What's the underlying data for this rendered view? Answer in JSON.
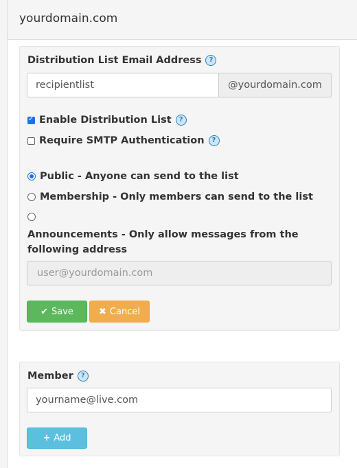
{
  "domain_title": "yourdomain.com",
  "dist_list": {
    "label": "Distribution List Email Address",
    "email_value": "recipientlist",
    "domain_suffix": "@yourdomain.com",
    "enable_label": "Enable Distribution List",
    "enable_checked": true,
    "smtp_label": "Require SMTP Authentication",
    "smtp_checked": false,
    "radio_public": "Public - Anyone can send to the list",
    "radio_membership": "Membership - Only members can send to the list",
    "radio_announcements": "Announcements - Only allow messages from the following address",
    "selected_radio": "public",
    "announce_placeholder": "user@yourdomain.com",
    "save_label": "Save",
    "cancel_label": "Cancel"
  },
  "member": {
    "label": "Member",
    "email_value": "yourname@live.com",
    "add_label": "Add"
  },
  "help_icon": "question-circle-icon",
  "colors": {
    "save": "#5cb85c",
    "cancel": "#f0ad4e",
    "add": "#5bc0de",
    "checkbox": "#1a73e8"
  }
}
